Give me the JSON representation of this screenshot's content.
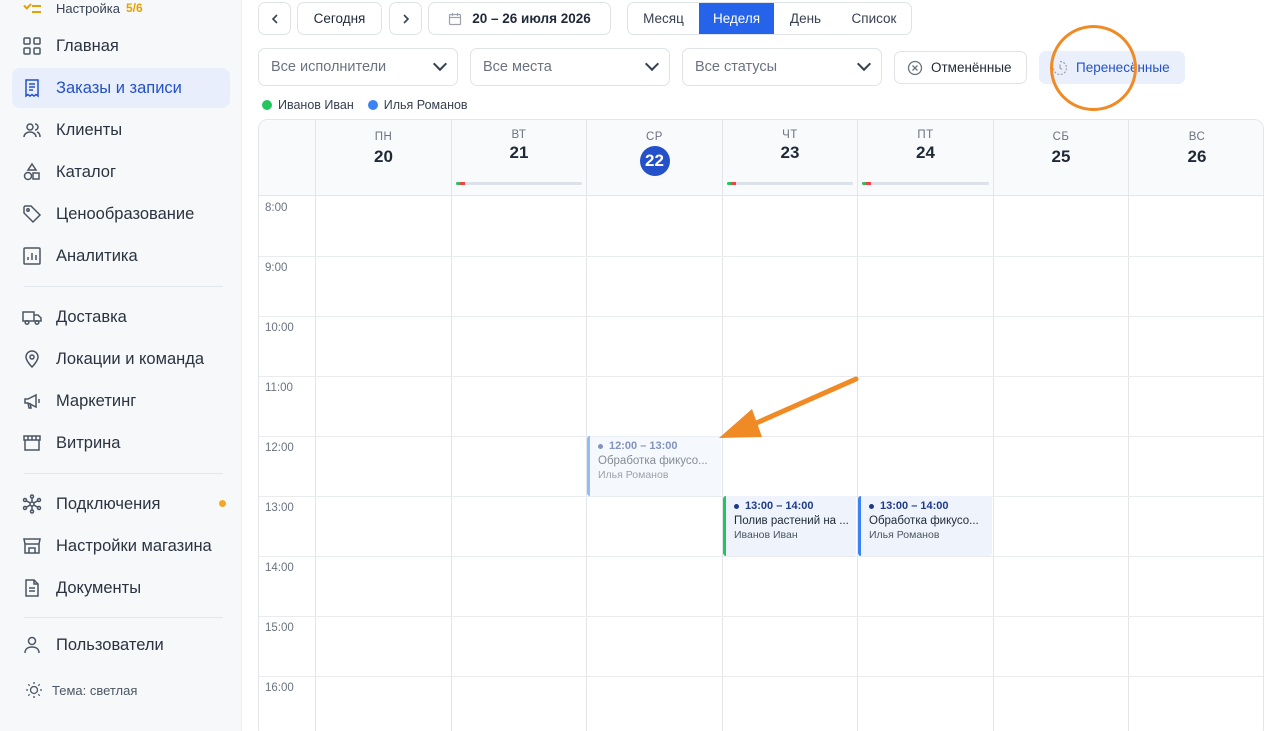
{
  "sidebar": {
    "setup": {
      "label": "Настройка",
      "count": "5/6"
    },
    "items": [
      {
        "label": "Главная",
        "icon": "grid-icon"
      },
      {
        "label": "Заказы и записи",
        "icon": "receipt-icon",
        "active": true
      },
      {
        "label": "Клиенты",
        "icon": "users-icon"
      },
      {
        "label": "Каталог",
        "icon": "shapes-icon"
      },
      {
        "label": "Ценообразование",
        "icon": "tag-icon"
      },
      {
        "label": "Аналитика",
        "icon": "chart-icon"
      },
      {
        "label": "Доставка",
        "icon": "truck-icon"
      },
      {
        "label": "Локации и команда",
        "icon": "location-pin-icon"
      },
      {
        "label": "Маркетинг",
        "icon": "megaphone-icon"
      },
      {
        "label": "Витрина",
        "icon": "storefront-icon"
      },
      {
        "label": "Подключения",
        "icon": "network-icon"
      },
      {
        "label": "Настройки магазина",
        "icon": "store-settings-icon"
      },
      {
        "label": "Документы",
        "icon": "document-icon"
      },
      {
        "label": "Пользователи",
        "icon": "user-icon"
      }
    ],
    "theme_label": "Тема: светлая"
  },
  "toolbar": {
    "today": "Сегодня",
    "date_range": "20 – 26 июля 2026",
    "views": [
      "Месяц",
      "Неделя",
      "День",
      "Список"
    ],
    "active_view": "Неделя"
  },
  "filters": {
    "performers": "Все исполнители",
    "places": "Все места",
    "statuses": "Все статусы",
    "cancelled": "Отменённые",
    "rescheduled": "Перенесённые"
  },
  "legend": [
    {
      "name": "Иванов Иван",
      "color": "#22c55e"
    },
    {
      "name": "Илья Романов",
      "color": "#3b82f6"
    }
  ],
  "calendar": {
    "days": [
      {
        "dn": "ПН",
        "dd": "20"
      },
      {
        "dn": "ВТ",
        "dd": "21",
        "load": true
      },
      {
        "dn": "СР",
        "dd": "22",
        "today": true
      },
      {
        "dn": "ЧТ",
        "dd": "23",
        "load": true
      },
      {
        "dn": "ПТ",
        "dd": "24",
        "load": true
      },
      {
        "dn": "СБ",
        "dd": "25"
      },
      {
        "dn": "ВС",
        "dd": "26"
      }
    ],
    "times": [
      "8:00",
      "9:00",
      "10:00",
      "11:00",
      "12:00",
      "13:00",
      "14:00",
      "15:00",
      "16:00"
    ],
    "events": [
      {
        "time": "12:00 – 13:00",
        "title": "Обработка фикусо...",
        "person": "Илья Романов",
        "color": "#3b82f6",
        "faded": true
      },
      {
        "time": "13:00 – 14:00",
        "title": "Полив растений на ...",
        "person": "Иванов Иван",
        "color": "#22c55e"
      },
      {
        "time": "13:00 – 14:00",
        "title": "Обработка фикусо...",
        "person": "Илья Романов",
        "color": "#3b82f6"
      }
    ]
  },
  "colors": {
    "accent": "#2563eb",
    "annotation": "#f08a24"
  }
}
